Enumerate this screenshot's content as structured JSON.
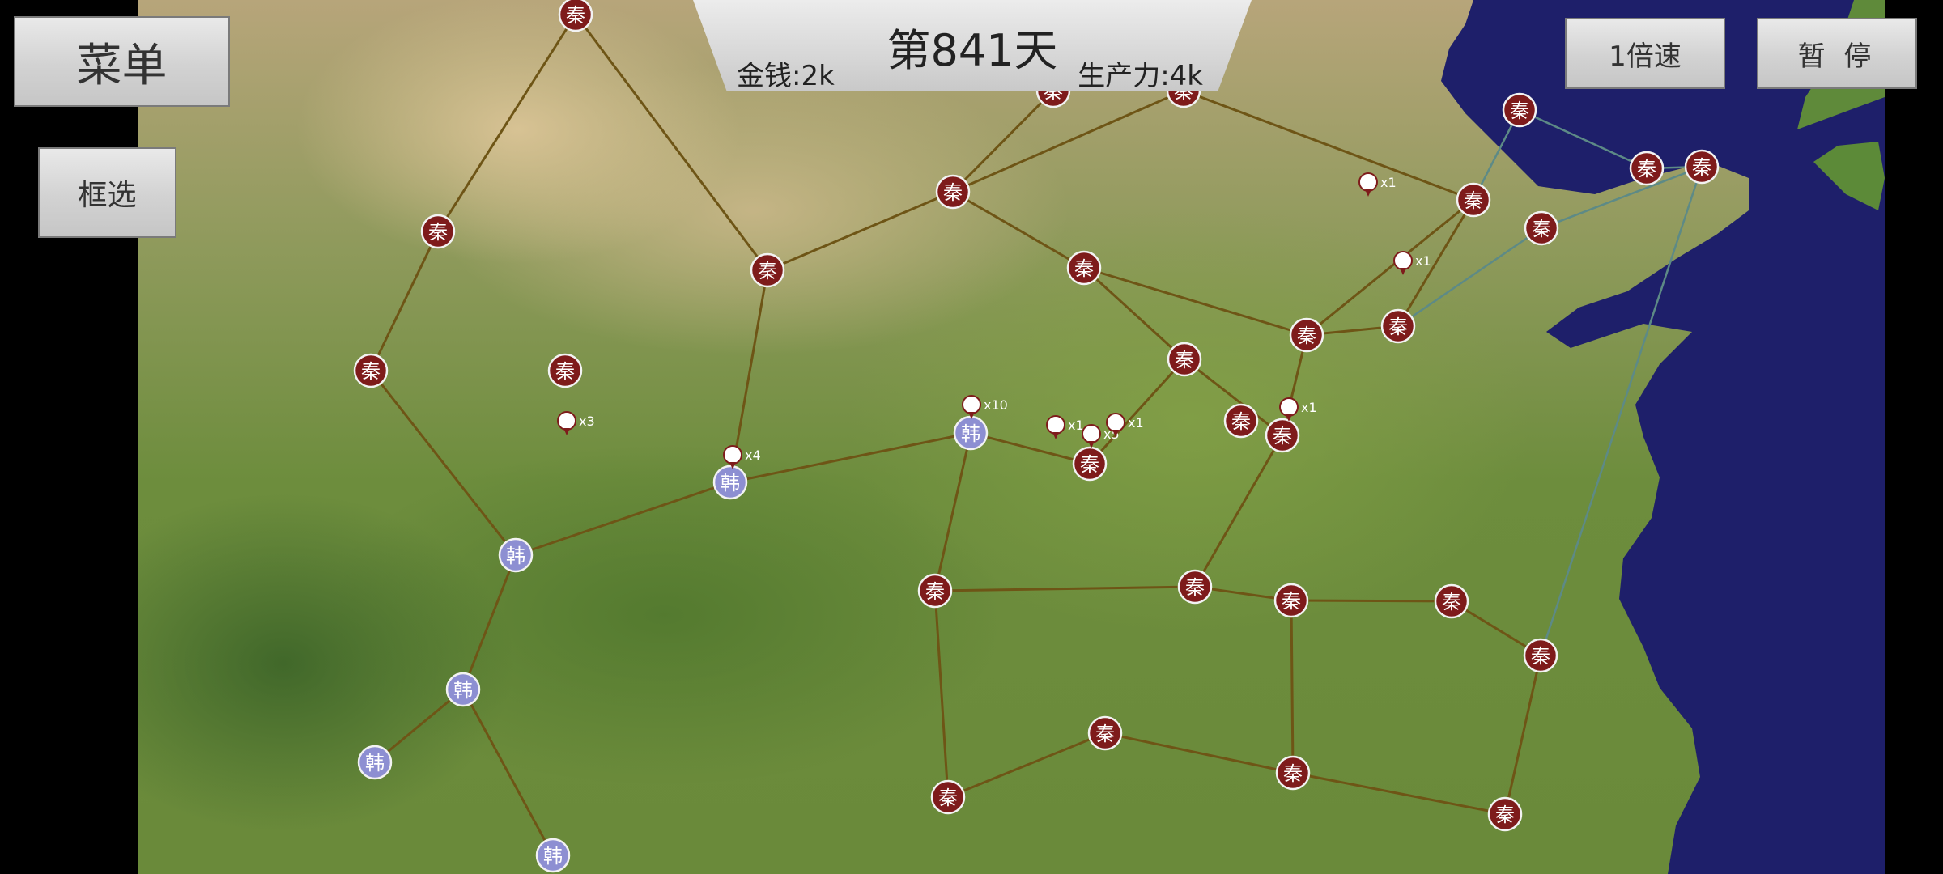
{
  "hud": {
    "day": "第841天",
    "gold": "金钱:2k",
    "production": "生产力:4k"
  },
  "buttons": {
    "menu": "菜单",
    "box_select": "框选",
    "speed": "1倍速",
    "pause": "暂 停"
  },
  "factions": {
    "qin": {
      "label": "秦",
      "color": "#7e1b1b"
    },
    "han": {
      "label": "韩",
      "color": "#8d8fd2"
    }
  },
  "cities": [
    {
      "id": "c0",
      "faction": "qin"
    },
    {
      "id": "c1",
      "faction": "qin"
    },
    {
      "id": "c2",
      "faction": "qin"
    },
    {
      "id": "c3",
      "faction": "qin"
    },
    {
      "id": "c4",
      "faction": "qin"
    },
    {
      "id": "c5",
      "faction": "qin"
    },
    {
      "id": "c6",
      "faction": "qin"
    },
    {
      "id": "c7",
      "faction": "qin"
    },
    {
      "id": "c8",
      "faction": "qin"
    },
    {
      "id": "c9",
      "faction": "qin"
    },
    {
      "id": "c10",
      "faction": "qin"
    },
    {
      "id": "c11",
      "faction": "qin"
    },
    {
      "id": "c12",
      "faction": "qin"
    },
    {
      "id": "c13",
      "faction": "qin"
    },
    {
      "id": "c14",
      "faction": "qin"
    },
    {
      "id": "c15",
      "faction": "qin"
    },
    {
      "id": "c16",
      "faction": "qin"
    },
    {
      "id": "c17",
      "faction": "qin"
    },
    {
      "id": "c18",
      "faction": "qin"
    },
    {
      "id": "c19",
      "faction": "qin"
    },
    {
      "id": "c20",
      "faction": "qin"
    },
    {
      "id": "c21",
      "faction": "qin"
    },
    {
      "id": "c22",
      "faction": "qin"
    },
    {
      "id": "c23",
      "faction": "qin"
    },
    {
      "id": "c24",
      "faction": "qin"
    },
    {
      "id": "c25",
      "faction": "qin"
    },
    {
      "id": "c26",
      "faction": "qin"
    },
    {
      "id": "c27",
      "faction": "qin"
    },
    {
      "id": "c28",
      "faction": "qin"
    },
    {
      "id": "h0",
      "faction": "han"
    },
    {
      "id": "h1",
      "faction": "han"
    },
    {
      "id": "h2",
      "faction": "han"
    },
    {
      "id": "h3",
      "faction": "han"
    },
    {
      "id": "h4",
      "faction": "han"
    },
    {
      "id": "h5",
      "faction": "han"
    }
  ],
  "roads": [
    [
      "c0",
      "c3"
    ],
    [
      "c0",
      "c1"
    ],
    [
      "c1",
      "c2"
    ],
    [
      "c2",
      "c13"
    ],
    [
      "c3",
      "c4"
    ],
    [
      "c3",
      "c5"
    ],
    [
      "c4",
      "c5"
    ],
    [
      "c4",
      "c6"
    ],
    [
      "c6",
      "c7"
    ],
    [
      "c6",
      "c8"
    ],
    [
      "c7",
      "c9"
    ],
    [
      "c8",
      "c9"
    ],
    [
      "c9",
      "c11"
    ],
    [
      "c9",
      "c10"
    ],
    [
      "c7",
      "c10"
    ],
    [
      "c10",
      "c12"
    ],
    [
      "c11",
      "c12"
    ],
    [
      "c2",
      "h0"
    ],
    [
      "c13",
      "h1"
    ],
    [
      "h1",
      "c10"
    ],
    [
      "h0",
      "h1"
    ],
    [
      "c5",
      "h1"
    ],
    [
      "h1",
      "h2"
    ],
    [
      "c16",
      "h2"
    ],
    [
      "c10",
      "c16"
    ],
    [
      "c16",
      "c18"
    ],
    [
      "c18",
      "c17"
    ],
    [
      "c18",
      "c19"
    ],
    [
      "c19",
      "c21"
    ],
    [
      "c19",
      "c20"
    ],
    [
      "c21",
      "c20"
    ],
    [
      "c20",
      "c22"
    ],
    [
      "c21",
      "c23"
    ],
    [
      "c23",
      "c22"
    ],
    [
      "h2",
      "c24"
    ],
    [
      "c24",
      "c23"
    ],
    [
      "c24",
      "c25"
    ],
    [
      "c0",
      "h3"
    ],
    [
      "h3",
      "h4"
    ],
    [
      "h4",
      "h5"
    ],
    [
      "h3",
      "h6"
    ]
  ],
  "sea_routes": [
    [
      "c15",
      "c14"
    ],
    [
      "c15",
      "c26"
    ],
    [
      "c14",
      "c27"
    ],
    [
      "c26",
      "c28"
    ],
    [
      "c28",
      "c22"
    ],
    [
      "c27",
      "c28"
    ]
  ],
  "units": [
    {
      "id": "u0",
      "count": "x3"
    },
    {
      "id": "u1",
      "count": "x4"
    },
    {
      "id": "u2",
      "count": "x10"
    },
    {
      "id": "u3",
      "count": "x1"
    },
    {
      "id": "u4",
      "count": "x5"
    },
    {
      "id": "u5",
      "count": "x1"
    },
    {
      "id": "u6",
      "count": "x1"
    },
    {
      "id": "u7",
      "count": "x1"
    },
    {
      "id": "u8",
      "count": "x1"
    }
  ]
}
